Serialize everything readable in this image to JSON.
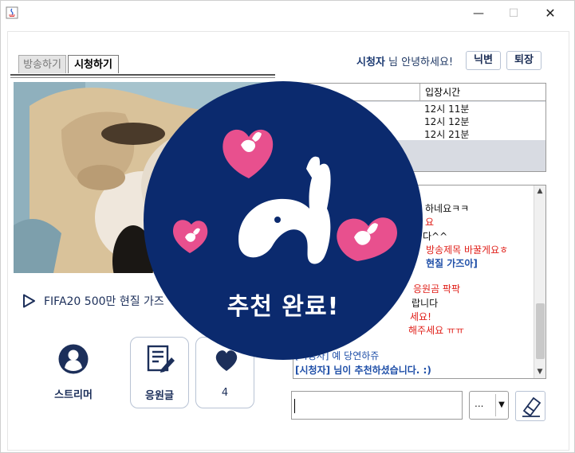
{
  "window": {
    "icon": "java-icon",
    "controls": {
      "minimize": "—",
      "maximize": "☐",
      "close": "✕"
    }
  },
  "tabs": [
    {
      "label": "방송하기",
      "active": false
    },
    {
      "label": "시청하기",
      "active": true
    }
  ],
  "header": {
    "user_name": "시청자",
    "greeting": " 님 안녕하세요!",
    "nickname_button": "닉변",
    "exit_button": "퇴장"
  },
  "viewer_table": {
    "columns": [
      "",
      "입장시간"
    ],
    "rows": [
      {
        "time": "12시 11분"
      },
      {
        "time": "12시 12분"
      },
      {
        "time": "12시 21분"
      }
    ]
  },
  "chat": {
    "lines": [
      {
        "text": "하네요ㅋㅋ",
        "color": "dark"
      },
      {
        "text": "요",
        "color": "red"
      },
      {
        "text": "다^^",
        "color": "dark"
      },
      {
        "text": "방송제목 바꿀게요ㅎ",
        "color": "red"
      },
      {
        "text": "현질 가즈아]",
        "color": "blue"
      },
      {
        "text": "응원곰 팍팍",
        "color": "red"
      },
      {
        "text": "랍니다",
        "color": "dark"
      },
      {
        "text": "세요!",
        "color": "red"
      },
      {
        "text": "해주세요 ㅠㅠ",
        "color": "red"
      },
      {
        "text": "[시청자] 예 당연하쥬",
        "color": "blue"
      },
      {
        "text": "[시청자] 님이 추천하셨습니다. :)",
        "color": "blue"
      }
    ]
  },
  "broadcast": {
    "title": "FIFA20 500만 현질 가즈"
  },
  "actions": [
    {
      "label": "스트리머",
      "icon": "user-icon"
    },
    {
      "label": "응원글",
      "icon": "edit-note-icon"
    },
    {
      "label": "4",
      "icon": "recommend-icon"
    }
  ],
  "input": {
    "value": "",
    "emoticon_select": "..."
  },
  "overlay": {
    "message": "추천 완료!"
  },
  "colors": {
    "navy": "#0b2a6e",
    "pink": "#e8508e",
    "red_text": "#e0201a",
    "blue_text": "#1f4fa8"
  }
}
